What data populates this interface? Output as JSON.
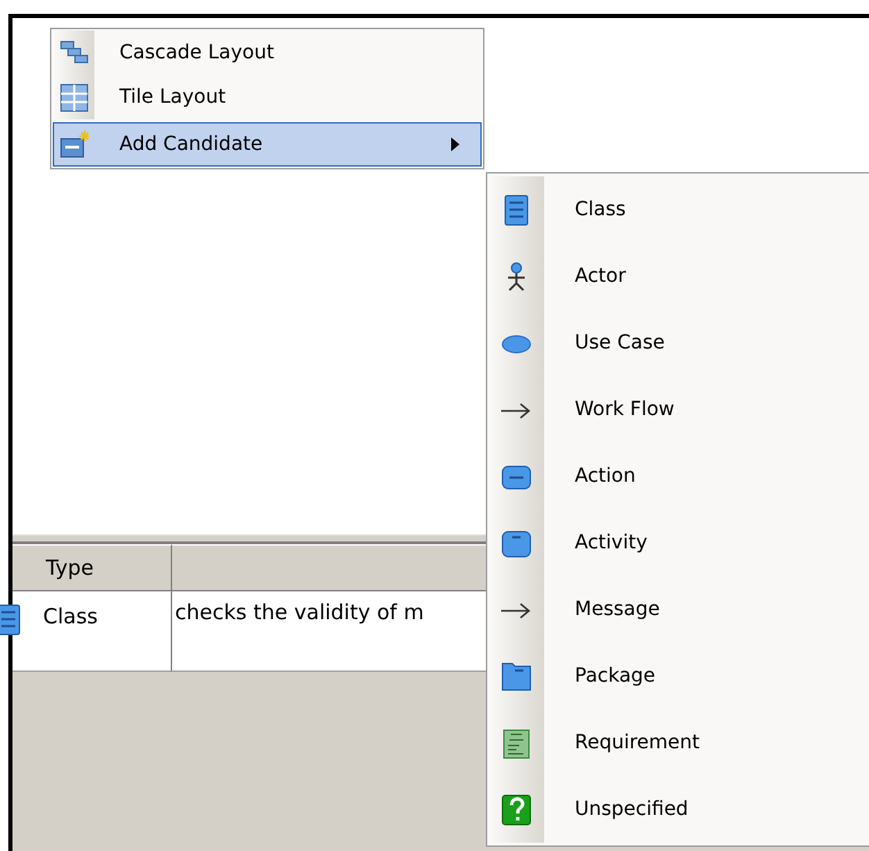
{
  "table": {
    "columns": [
      {
        "label": "Type"
      },
      {}
    ],
    "rows": [
      {
        "type": "Class",
        "column_2": "checks the validity of m"
      }
    ]
  },
  "context_menu": {
    "items": [
      {
        "label": "Cascade Layout",
        "kind": "cascade",
        "highlighted": false,
        "submenu": false
      },
      {
        "label": "Tile Layout",
        "kind": "tile",
        "highlighted": false,
        "submenu": false
      },
      {
        "label": "Add Candidate",
        "kind": "candidate",
        "highlighted": true,
        "submenu": true
      }
    ]
  },
  "submenu": {
    "items": [
      {
        "label": "Class",
        "kind": "class"
      },
      {
        "label": "Actor",
        "kind": "actor"
      },
      {
        "label": "Use Case",
        "kind": "usecase"
      },
      {
        "label": "Work Flow",
        "kind": "arrow"
      },
      {
        "label": "Action",
        "kind": "action"
      },
      {
        "label": "Activity",
        "kind": "activity"
      },
      {
        "label": "Message",
        "kind": "arrow"
      },
      {
        "label": "Package",
        "kind": "package"
      },
      {
        "label": "Requirement",
        "kind": "requirement"
      },
      {
        "label": "Unspecified",
        "kind": "unspecified"
      }
    ]
  }
}
